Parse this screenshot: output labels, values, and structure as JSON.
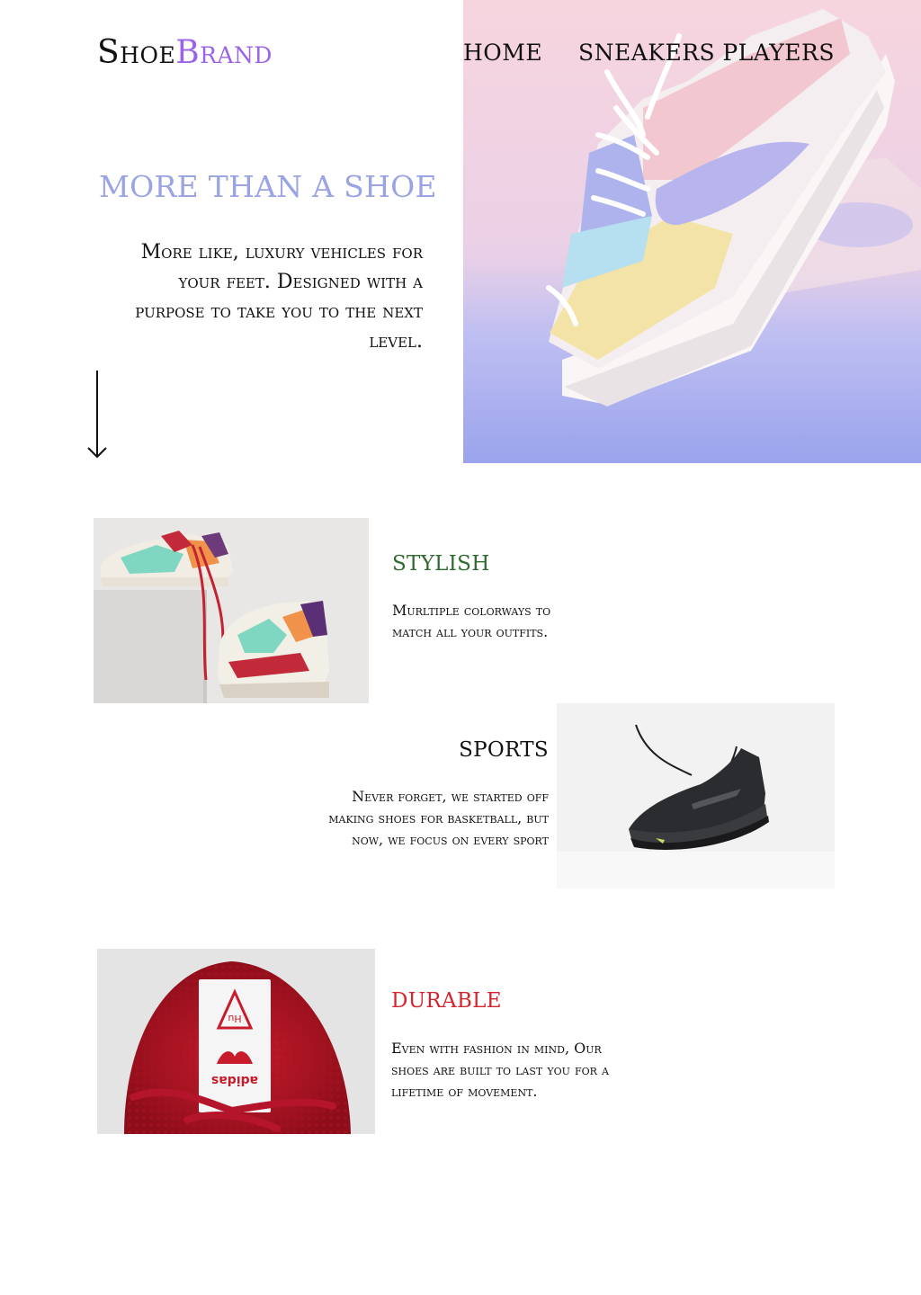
{
  "header": {
    "logo": {
      "part1": "Shoe",
      "part2": "Brand"
    },
    "nav": [
      "HOME",
      "SNEAKERS",
      "PLAYERS"
    ]
  },
  "hero": {
    "title": "MORE THAN A SHOE",
    "text": "More like, luxury vehicles for your feet. Designed with a purpose to take you to the next level.",
    "scroll_icon": "arrow-down-icon",
    "image_icon": "pastel-sneaker-photo"
  },
  "features": [
    {
      "title": "STYLISH",
      "text": "Murltiple colorways to match all your outfits.",
      "title_color": "#2f6b2e",
      "image_icon": "colorful-sneakers-photo"
    },
    {
      "title": "SPORTS",
      "text": "Never forget, we started off making shoes for basketball, but now, we focus on every sport",
      "title_color": "#111111",
      "image_icon": "black-basketball-shoe-photo"
    },
    {
      "title": "DURABLE",
      "text": "Even with fashion in mind, Our shoes are built to last you for a lifetime of movement.",
      "title_color": "#d4252f",
      "image_icon": "red-knit-shoe-photo"
    }
  ],
  "colors": {
    "brand_accent": "#9a63ea",
    "hero_title": "#9aa3e4"
  }
}
